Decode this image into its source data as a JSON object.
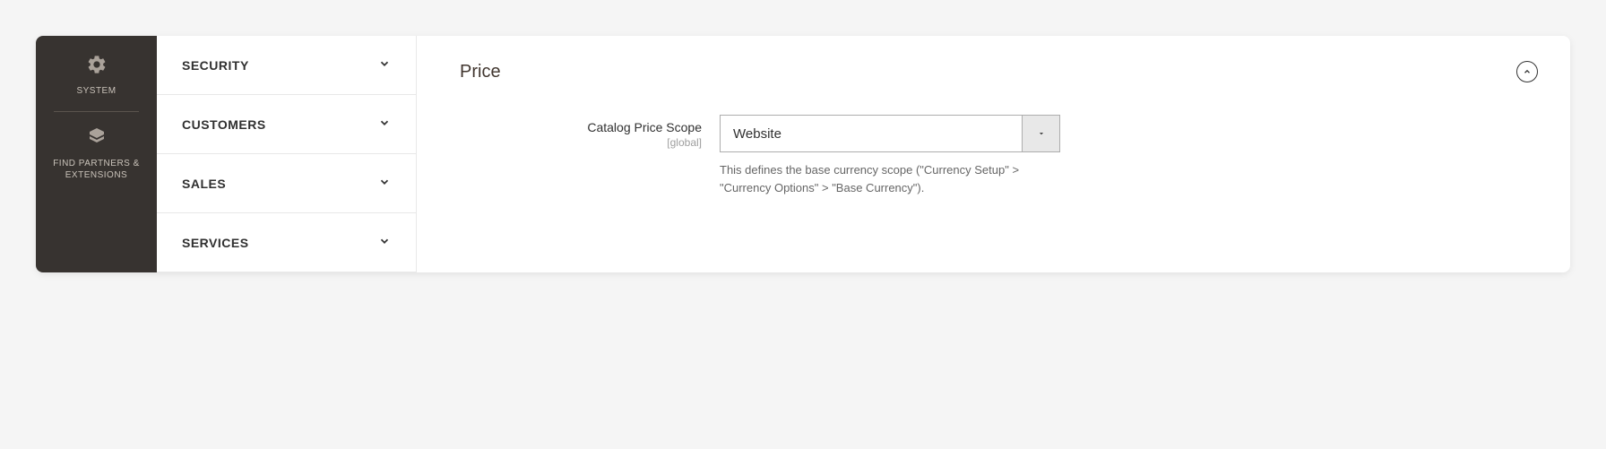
{
  "sidebar_dark": {
    "items": [
      {
        "label": "SYSTEM"
      },
      {
        "label": "FIND PARTNERS & EXTENSIONS"
      }
    ]
  },
  "sidebar_tabs": {
    "items": [
      {
        "label": "SECURITY"
      },
      {
        "label": "CUSTOMERS"
      },
      {
        "label": "SALES"
      },
      {
        "label": "SERVICES"
      }
    ]
  },
  "main": {
    "section_title": "Price",
    "field": {
      "label": "Catalog Price Scope",
      "scope": "[global]",
      "value": "Website",
      "note": "This defines the base currency scope (\"Currency Setup\" > \"Currency Options\" > \"Base Currency\")."
    }
  }
}
